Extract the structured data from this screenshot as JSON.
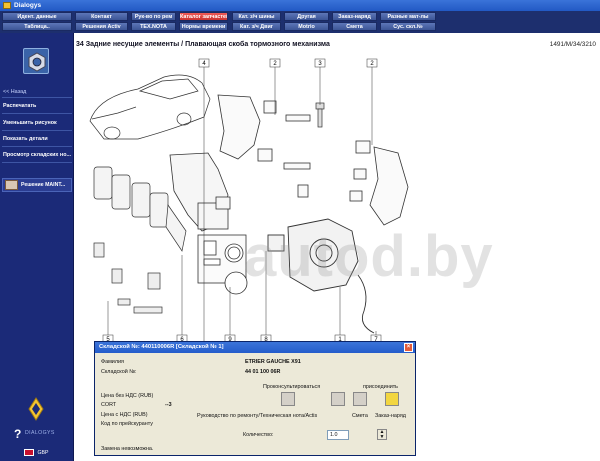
{
  "window": {
    "title": "Dialogys"
  },
  "nav": {
    "row1": [
      {
        "label": "Идент. данные",
        "active": false
      },
      {
        "label": "Контакт",
        "active": false
      },
      {
        "label": "Рук-во по рем",
        "active": false
      },
      {
        "label": "Каталог запчастей",
        "active": true
      },
      {
        "label": "Кат. з/ч шины",
        "active": false
      },
      {
        "label": "Другая",
        "active": false
      },
      {
        "label": "Заказ-наряд",
        "active": false
      },
      {
        "label": "Разные мат-лы",
        "active": false
      }
    ],
    "row2": [
      {
        "label": "Таблица..",
        "active": false
      },
      {
        "label": "Решения Activ",
        "active": false
      },
      {
        "label": "TEX.NOTA",
        "active": false
      },
      {
        "label": "Нормы времени",
        "active": false
      },
      {
        "label": "Кат. з/ч Двиг",
        "active": false
      },
      {
        "label": "Motrio",
        "active": false
      },
      {
        "label": "Смета",
        "active": false
      },
      {
        "label": "Сус. скл.№",
        "active": false
      }
    ]
  },
  "sidebar": {
    "back": "<< Назад",
    "items": [
      "Распечатать",
      "Уменьшить рисунок",
      "Показать детали",
      "Просмотр складских но..."
    ],
    "solution": "Решение MAINT...",
    "brand": "DIALOGYS",
    "lang": "GBP"
  },
  "content": {
    "title": "34 Задние несущие элементы / Плавающая скоба тормозного механизма",
    "ref": "1491/M/34/3210",
    "watermark": "autod.by",
    "callouts": [
      "4",
      "2",
      "3",
      "2",
      "5",
      "6",
      "9",
      "8",
      "1",
      "7"
    ]
  },
  "popup": {
    "title": "Складской №: 440110006R [Складской № 1]",
    "close": "×",
    "family_label": "Фамилия",
    "family_value": "ETRIER GAUCHE X91",
    "stock_label": "Складской №:",
    "stock_value": "44 01 100 06R",
    "consult_label": "Проконсультироваться",
    "attach_label": "присоединить",
    "price_nds_label": "Цена без НДС (RUB)",
    "cort_label": "CORT",
    "cort_value": "--3",
    "price_label": "Цена с НДС (RUB)",
    "code_label": "Код по прейскуранту",
    "manual_label": "Руководство по ремонту/Техническая нота/Actis",
    "estimate_label": "Смета",
    "order_label": "Заказ-наряд",
    "qty_label": "Количество:",
    "qty_value": "1.0",
    "no_replace": "Замена невозможна."
  }
}
